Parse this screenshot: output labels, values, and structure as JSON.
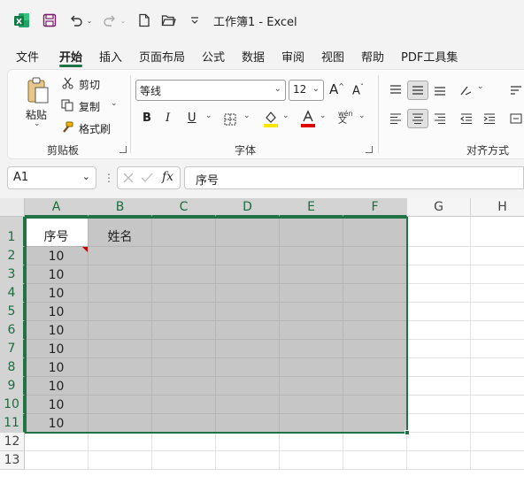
{
  "title_bar": {
    "title": "工作簿1 - Excel",
    "icons": [
      "excel-logo-icon",
      "save-icon",
      "undo-icon",
      "redo-icon",
      "new-file-icon",
      "open-folder-icon",
      "customize-qat-icon"
    ]
  },
  "tabs": [
    "文件",
    "开始",
    "插入",
    "页面布局",
    "公式",
    "数据",
    "审阅",
    "视图",
    "帮助",
    "PDF工具集"
  ],
  "active_tab": "开始",
  "ribbon": {
    "clipboard": {
      "paste_label": "粘贴",
      "cut_label": "剪切",
      "copy_label": "复制",
      "format_painter_label": "格式刷",
      "group_label": "剪贴板"
    },
    "font": {
      "font_name": "等线",
      "font_size": "12",
      "bold": "B",
      "italic": "I",
      "underline": "U",
      "phonetic": "wén",
      "group_label": "字体"
    },
    "alignment": {
      "group_label": "对齐方式"
    }
  },
  "formula_bar": {
    "name_box": "A1",
    "fx_label": "fx",
    "content": "序号"
  },
  "grid": {
    "columns": [
      "A",
      "B",
      "C",
      "D",
      "E",
      "F",
      "G",
      "H"
    ],
    "rows": [
      "1",
      "2",
      "3",
      "4",
      "5",
      "6",
      "7",
      "8",
      "9",
      "10",
      "11",
      "12",
      "13"
    ],
    "cells": {
      "A1": "序号",
      "B1": "姓名",
      "A2": "10",
      "A3": "10",
      "A4": "10",
      "A5": "10",
      "A6": "10",
      "A7": "10",
      "A8": "10",
      "A9": "10",
      "A10": "10",
      "A11": "10"
    },
    "selection": "A1:F11"
  },
  "colors": {
    "accent": "#217346",
    "selection_fill": "#c6c6c6",
    "error_indicator": "#c00000"
  }
}
